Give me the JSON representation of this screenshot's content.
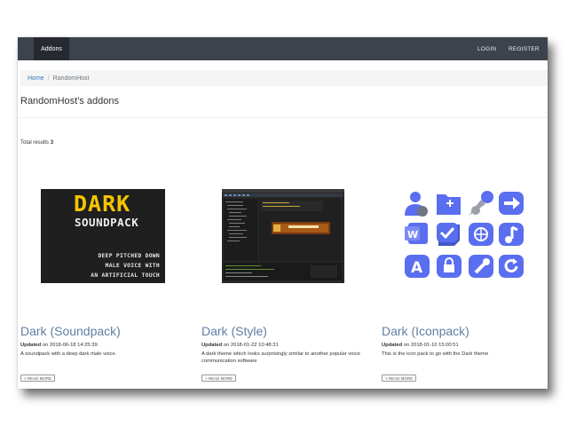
{
  "navbar": {
    "brand": "Addons",
    "login": "LOGIN",
    "register": "REGISTER"
  },
  "breadcrumb": {
    "home": "Home",
    "separator": "/",
    "current": "RandomHost"
  },
  "page_title": "RandomHost's addons",
  "total": {
    "label": "Total results",
    "count": "3"
  },
  "cards": [
    {
      "title": "Dark (Soundpack)",
      "updated_label": "Updated",
      "updated_text": " on 2018-06-18 14:25:39",
      "description": "A soundpack with a deep dark male voice.",
      "read_more": "> READ MORE",
      "thumb_text": {
        "line1": "DARK",
        "line2": "SOUNDPACK",
        "line3": "DEEP PITCHED DOWN",
        "line4": "MALE VOICE WITH",
        "line5": "AN ARTIFICIAL TOUCH"
      }
    },
    {
      "title": "Dark (Style)",
      "updated_label": "Updated",
      "updated_text": " on 2018-01-22 10:48:31",
      "description": "A dark theme which looks surprisingly similar to another popular voice communication software",
      "read_more": "> READ MORE"
    },
    {
      "title": "Dark (Iconpack)",
      "updated_label": "Updated",
      "updated_text": " on 2018-01-10 15:00:51",
      "description": "This is the icon pack to go with the Dark theme",
      "read_more": "> READ MORE"
    }
  ],
  "colors": {
    "navbar": "#3d434d",
    "brand_bg": "#262a30",
    "title_link": "#5f7fa3",
    "icon_blue": "#5a6ef0",
    "soundpack_yellow": "#f5c400"
  },
  "icons": [
    "user-icon",
    "add-folder-icon",
    "pin-icon",
    "arrow-right-icon",
    "word-icon",
    "check-icon",
    "globe-icon",
    "music-icon",
    "font-icon",
    "lock-icon",
    "wrench-icon",
    "refresh-icon"
  ]
}
